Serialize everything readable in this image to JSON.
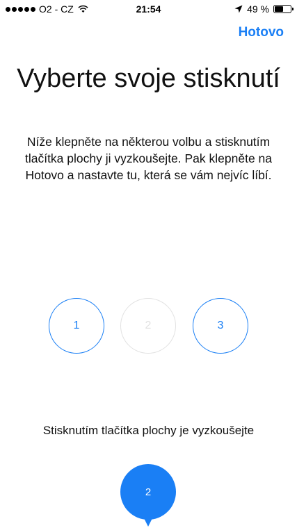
{
  "status_bar": {
    "carrier": "O2 - CZ",
    "time": "21:54",
    "battery_percent": "49 %",
    "battery_level": 0.49,
    "icons": [
      "signal-dots-icon",
      "wifi-icon",
      "location-arrow-icon",
      "battery-icon"
    ]
  },
  "nav": {
    "done_label": "Hotovo"
  },
  "header": {
    "title": "Vyberte svoje stisknutí",
    "description": "Níže klepněte na některou volbu a stisknutím tlačítka plochy ji vyzkoušejte. Pak klepněte na Hotovo a nastavte tu, která se vám nejvíc líbí."
  },
  "options": [
    {
      "label": "1",
      "state": "unselected"
    },
    {
      "label": "2",
      "state": "selected"
    },
    {
      "label": "3",
      "state": "unselected"
    }
  ],
  "try_it": {
    "label": "Stisknutím tlačítka plochy je vyzkoušejte",
    "selected_label": "2"
  },
  "colors": {
    "accent": "#1a7ff5",
    "inactive_border": "#e2e2e2",
    "text": "#111111",
    "background": "#ffffff"
  }
}
